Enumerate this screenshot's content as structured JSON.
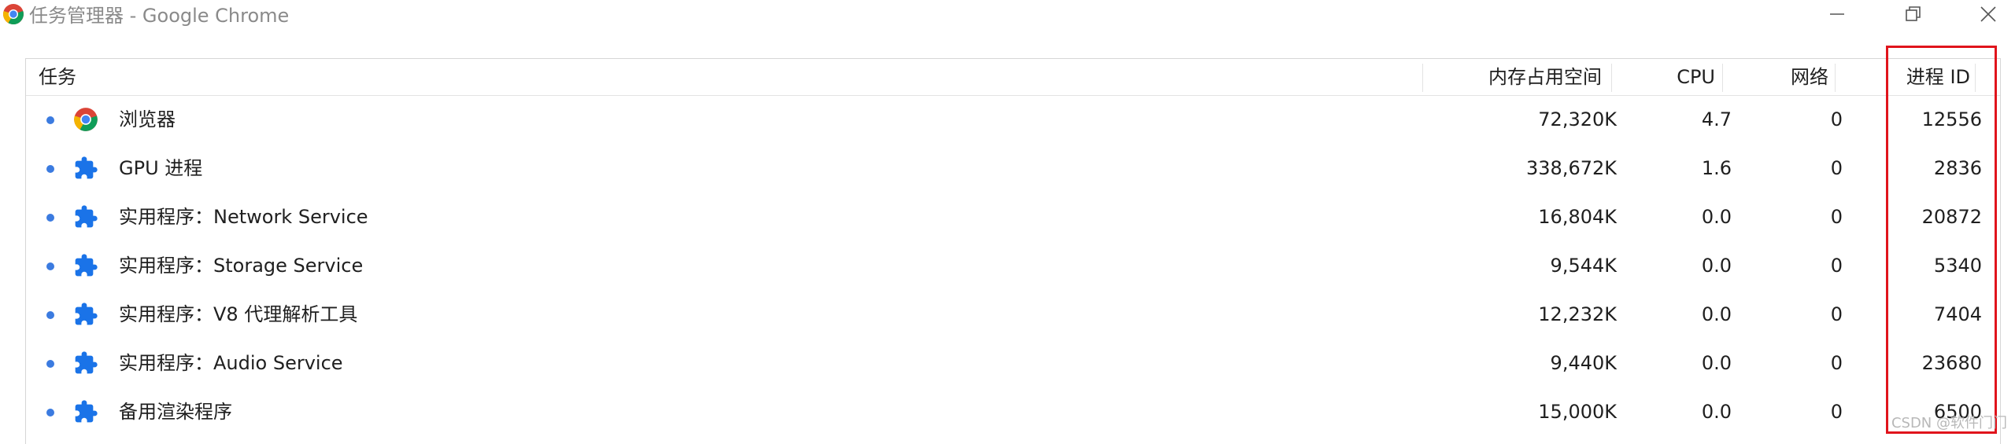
{
  "window": {
    "title": "任务管理器 - Google Chrome",
    "app_icon": "chrome-logo-icon",
    "controls": [
      "minimize-icon",
      "restore-icon",
      "close-icon"
    ]
  },
  "table": {
    "columns": {
      "task": "任务",
      "memory": "内存占用空间",
      "cpu": "CPU",
      "network": "网络",
      "pid": "进程 ID"
    },
    "rows": [
      {
        "icon": "chrome-logo-icon",
        "task": "浏览器",
        "memory": "72,320K",
        "cpu": "4.7",
        "network": "0",
        "pid": "12556"
      },
      {
        "icon": "puzzle-piece-icon",
        "task": "GPU 进程",
        "memory": "338,672K",
        "cpu": "1.6",
        "network": "0",
        "pid": "2836"
      },
      {
        "icon": "puzzle-piece-icon",
        "task": "实用程序：Network Service",
        "memory": "16,804K",
        "cpu": "0.0",
        "network": "0",
        "pid": "20872"
      },
      {
        "icon": "puzzle-piece-icon",
        "task": "实用程序：Storage Service",
        "memory": "9,544K",
        "cpu": "0.0",
        "network": "0",
        "pid": "5340"
      },
      {
        "icon": "puzzle-piece-icon",
        "task": "实用程序：V8 代理解析工具",
        "memory": "12,232K",
        "cpu": "0.0",
        "network": "0",
        "pid": "7404"
      },
      {
        "icon": "puzzle-piece-icon",
        "task": "实用程序：Audio Service",
        "memory": "9,440K",
        "cpu": "0.0",
        "network": "0",
        "pid": "23680"
      },
      {
        "icon": "puzzle-piece-icon",
        "task": "备用渲染程序",
        "memory": "15,000K",
        "cpu": "0.0",
        "network": "0",
        "pid": "6500"
      }
    ]
  },
  "annotation": {
    "color": "#e0141c",
    "target_column": "pid"
  },
  "watermark": "CSDN @软件门门",
  "colors": {
    "bullet": "#3b7be0",
    "extension_icon": "#1a73e8",
    "title_text": "#8a8a8a"
  }
}
